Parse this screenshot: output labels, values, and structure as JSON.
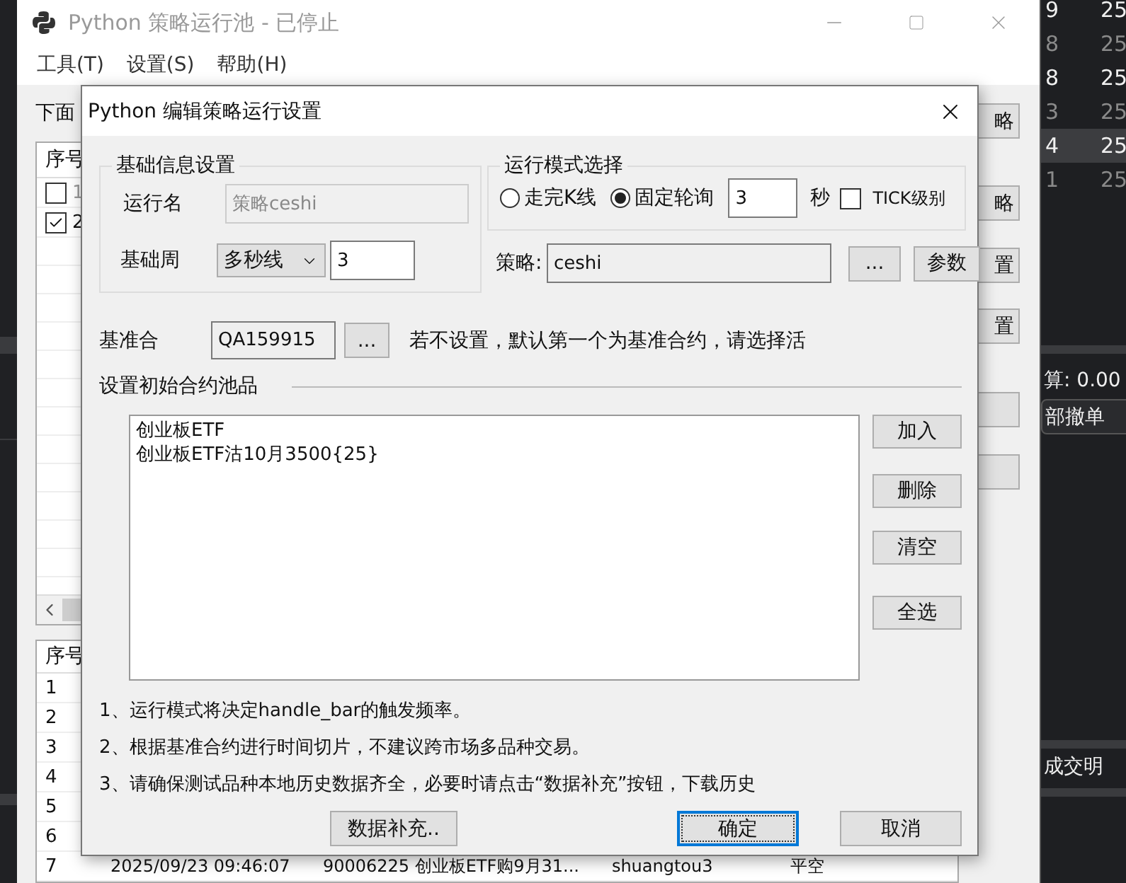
{
  "main_window": {
    "title": "Python 策略运行池 - 已停止",
    "menu": [
      "工具(T)",
      "设置(S)",
      "帮助(H)"
    ],
    "intro_text": "下面",
    "top_table": {
      "header": "序号",
      "rows": [
        {
          "number": "1",
          "checked": false,
          "disabled": true
        },
        {
          "number": "2",
          "checked": true,
          "disabled": false
        }
      ]
    },
    "side_buttons": [
      {
        "kind": "labeled",
        "label": "略"
      },
      {
        "kind": "labeled",
        "label": "略"
      },
      {
        "kind": "labeled",
        "label": "置"
      },
      {
        "kind": "labeled",
        "label": "置"
      },
      {
        "kind": "blank"
      },
      {
        "kind": "blank"
      }
    ],
    "bottom_table": {
      "header": "序号",
      "rows": [
        {
          "number": "1"
        },
        {
          "number": "2"
        },
        {
          "number": "3"
        },
        {
          "number": "4"
        },
        {
          "number": "5"
        },
        {
          "number": "6"
        },
        {
          "number": "7",
          "cells": [
            "2025/09/23 09:46:07",
            "90006225 创业板ETF购9月31...",
            "shuangtou3",
            "平空"
          ]
        }
      ]
    }
  },
  "dialog": {
    "title": "Python 编辑策略运行设置",
    "basic_group": {
      "title": "基础信息设置",
      "run_name_label": "运行名",
      "run_name": "策略ceshi",
      "run_name_disabled": true,
      "period_label": "基础周",
      "period_type": "多秒线",
      "period_value": "3"
    },
    "mode_group": {
      "title": "运行模式选择",
      "options": [
        {
          "label": "走完K线",
          "selected": false
        },
        {
          "label": "固定轮询",
          "selected": true
        }
      ],
      "interval": "3",
      "unit": "秒",
      "tick": {
        "label": "TICK级别",
        "checked": false
      }
    },
    "strategy": {
      "label": "策略:",
      "value": "ceshi",
      "browse_button": "...",
      "params_button": "参数"
    },
    "benchmark": {
      "label": "基准合",
      "value": "QA159915",
      "browse_button": "...",
      "hint": "若不设置，默认第一个为基准合约，请选择活"
    },
    "pool": {
      "title": "设置初始合约池品",
      "items": [
        "创业板ETF",
        "创业板ETF沽10月3500{25}"
      ],
      "buttons": [
        "加入",
        "删除",
        "清空",
        "全选"
      ]
    },
    "notes": [
      "1、运行模式将决定handle_bar的触发频率。",
      "2、根据基准合约进行时间切片，不建议跨市场多品种交易。",
      "3、请确保测试品种本地历史数据齐全，必要时请点击“数据补充”按钮，下载历史"
    ],
    "footer_buttons": [
      {
        "label": "数据补充..",
        "default": false
      },
      {
        "label": "确定",
        "default": true
      },
      {
        "label": "取消",
        "default": false
      }
    ]
  },
  "right_panel": {
    "rows": [
      {
        "column_1": "9",
        "column_2": "25",
        "dim": false,
        "selected": false
      },
      {
        "column_1": "8",
        "column_2": "25",
        "dim": true,
        "selected": false
      },
      {
        "column_1": "8",
        "column_2": "25",
        "dim": false,
        "selected": false
      },
      {
        "column_1": "3",
        "column_2": "25",
        "dim": true,
        "selected": false
      },
      {
        "column_1": "4",
        "column_2": "25",
        "dim": false,
        "selected": true
      },
      {
        "column_1": "1",
        "column_2": "25",
        "dim": true,
        "selected": false
      }
    ],
    "summary": "算: 0.00",
    "cancel_button": "部撤单",
    "tab": "成交明"
  }
}
